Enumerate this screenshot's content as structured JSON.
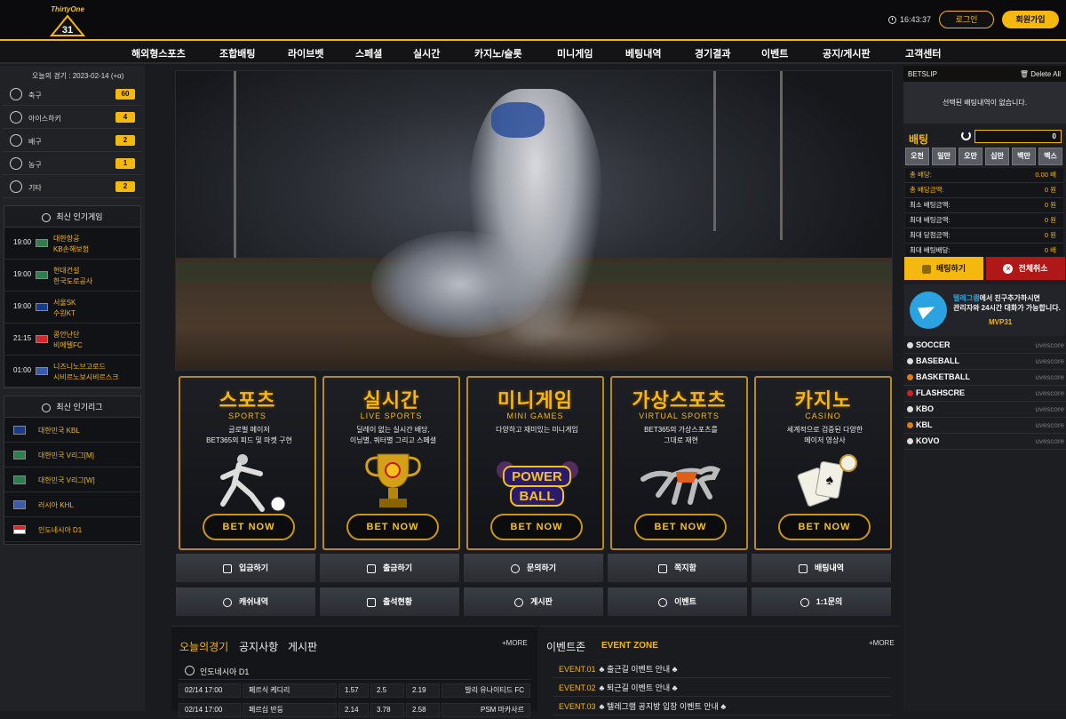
{
  "brand": {
    "name": "ThirtyOne",
    "number": "31"
  },
  "header": {
    "time": "16:43:37",
    "login_label": "로그인",
    "join_label": "회원가입"
  },
  "nav": [
    "해외형스포츠",
    "조합배팅",
    "라이브벳",
    "스페셜",
    "실시간",
    "카지노/슬롯",
    "미니게임",
    "베팅내역",
    "경기결과",
    "이벤트",
    "공지/게시판",
    "고객센터"
  ],
  "left": {
    "today_label": "오늘의 경기 : 2023-02-14 (+α)",
    "sports": [
      {
        "label": "축구",
        "count": "60",
        "icon": "soccer-icon"
      },
      {
        "label": "아이스하키",
        "count": "4",
        "icon": "hockey-icon"
      },
      {
        "label": "배구",
        "count": "2",
        "icon": "volleyball-icon"
      },
      {
        "label": "농구",
        "count": "1",
        "icon": "basketball-icon"
      },
      {
        "label": "기타",
        "count": "2",
        "icon": "question-icon"
      }
    ],
    "popular_games_title": "최신 인기게임",
    "popular_games": [
      {
        "time": "19:00",
        "home": "대한항공",
        "away": "KB손해보험"
      },
      {
        "time": "19:00",
        "home": "현대건설",
        "away": "한국도로공사"
      },
      {
        "time": "19:00",
        "home": "서울SK",
        "away": "수원KT"
      },
      {
        "time": "21:15",
        "home": "콩안난단",
        "away": "비에텔FC"
      },
      {
        "time": "01:00",
        "home": "니즈니노브고로드",
        "away": "시비르노보시비르스크"
      }
    ],
    "popular_leagues_title": "최신 인기리그",
    "popular_leagues": [
      "대한민국 KBL",
      "대한민국 V리그[M]",
      "대한민국 V리그[W]",
      "러시아 KHL",
      "인도네시아 D1"
    ]
  },
  "cards": [
    {
      "title": "스포츠",
      "sub": "SPORTS",
      "desc1": "글로벌 메이저",
      "desc2": "BET365의 피드 및 마켓 구현",
      "btn": "BET NOW"
    },
    {
      "title": "실시간",
      "sub": "LIVE SPORTS",
      "desc1": "딜레이 없는 실시간 배당,",
      "desc2": "이닝별, 쿼터별 그리고 스페셜",
      "btn": "BET NOW"
    },
    {
      "title": "미니게임",
      "sub": "MINI GAMES",
      "desc1": "다양하고 재미있는 미니게임",
      "desc2": "",
      "btn": "BET NOW",
      "art1": "POWER",
      "art2": "BALL"
    },
    {
      "title": "가상스포츠",
      "sub": "VIRTUAL SPORTS",
      "desc1": "BET365의 가상스포츠를",
      "desc2": "그대로 재현",
      "btn": "BET NOW"
    },
    {
      "title": "카지노",
      "sub": "CASINO",
      "desc1": "세계적으로 검증된 다양한",
      "desc2": "메이저 영상사",
      "btn": "BET NOW"
    }
  ],
  "quick": [
    {
      "label": "입금하기",
      "icon": "deposit-icon"
    },
    {
      "label": "출금하기",
      "icon": "withdraw-icon"
    },
    {
      "label": "문의하기",
      "icon": "inquiry-icon"
    },
    {
      "label": "쪽지함",
      "icon": "mail-icon"
    },
    {
      "label": "배팅내역",
      "icon": "calendar-icon"
    },
    {
      "label": "캐쉬내역",
      "icon": "clock-icon"
    },
    {
      "label": "출석현황",
      "icon": "keyboard-icon"
    },
    {
      "label": "게시판",
      "icon": "users-icon"
    },
    {
      "label": "이벤트",
      "icon": "user-icon"
    },
    {
      "label": "1:1문의",
      "icon": "chat-icon"
    }
  ],
  "bottom": {
    "tabs": [
      "오늘의경기",
      "공지사항",
      "게시판"
    ],
    "more": "+MORE",
    "league": "인도네시아 D1",
    "matches": [
      {
        "date": "02/14 17:00",
        "home": "페르식 케디리",
        "o1": "1.57",
        "o2": "2.5",
        "o3": "2.19",
        "away": "발리 유나이티드 FC"
      },
      {
        "date": "02/14 17:00",
        "home": "페르십 반둥",
        "o1": "2.14",
        "o2": "3.78",
        "o3": "2.58",
        "away": "PSM 마카사르"
      }
    ],
    "event_title": "이벤트존",
    "event_title_en": "EVENT ZONE",
    "events": [
      {
        "no": "EVENT.01",
        "text": "♣ 출근길 이벤트 안내 ♣"
      },
      {
        "no": "EVENT.02",
        "text": "♣ 퇴근길 이벤트 안내 ♣"
      },
      {
        "no": "EVENT.03",
        "text": "♣ 텔레그램 공지방 입장 이벤트 안내 ♣"
      }
    ]
  },
  "betslip": {
    "title": "BETSLIP",
    "delete_all": "Delete All",
    "empty": "선택된 배팅내역이 없습니다.",
    "bet_label": "배팅",
    "amount": "0",
    "chips": [
      "오천",
      "일만",
      "오만",
      "십만",
      "백만",
      "맥스"
    ],
    "info": [
      {
        "label": "총 배당:",
        "value": "0.00 배",
        "hl": true
      },
      {
        "label": "총 배당금액:",
        "value": "0 원",
        "hl": true
      },
      {
        "label": "최소 배팅금액:",
        "value": "0 원",
        "hl": false
      },
      {
        "label": "최대 배팅금액:",
        "value": "0 원",
        "hl": false
      },
      {
        "label": "최대 당첨금액:",
        "value": "0 원",
        "hl": false
      },
      {
        "label": "최대 배팅배당:",
        "value": "0 배",
        "hl": false
      }
    ],
    "bet_btn": "배팅하기",
    "cancel_btn": "전체취소",
    "telegram_line1": "텔레그램에서 친구추가하시면",
    "telegram_brand": "텔레그램",
    "telegram_line2": "관리자와 24시간 대화가 가능합니다.",
    "telegram_id": "MVP31",
    "livescores": [
      {
        "name": "SOCCER",
        "tag": "uvescore"
      },
      {
        "name": "BASEBALL",
        "tag": "uvescore"
      },
      {
        "name": "BASKETBALL",
        "tag": "uvescore"
      },
      {
        "name": "FLASHSCRE",
        "tag": "uvescore"
      },
      {
        "name": "KBO",
        "tag": "uvescore"
      },
      {
        "name": "KBL",
        "tag": "uvescore"
      },
      {
        "name": "KOVO",
        "tag": "uvescore"
      }
    ]
  }
}
